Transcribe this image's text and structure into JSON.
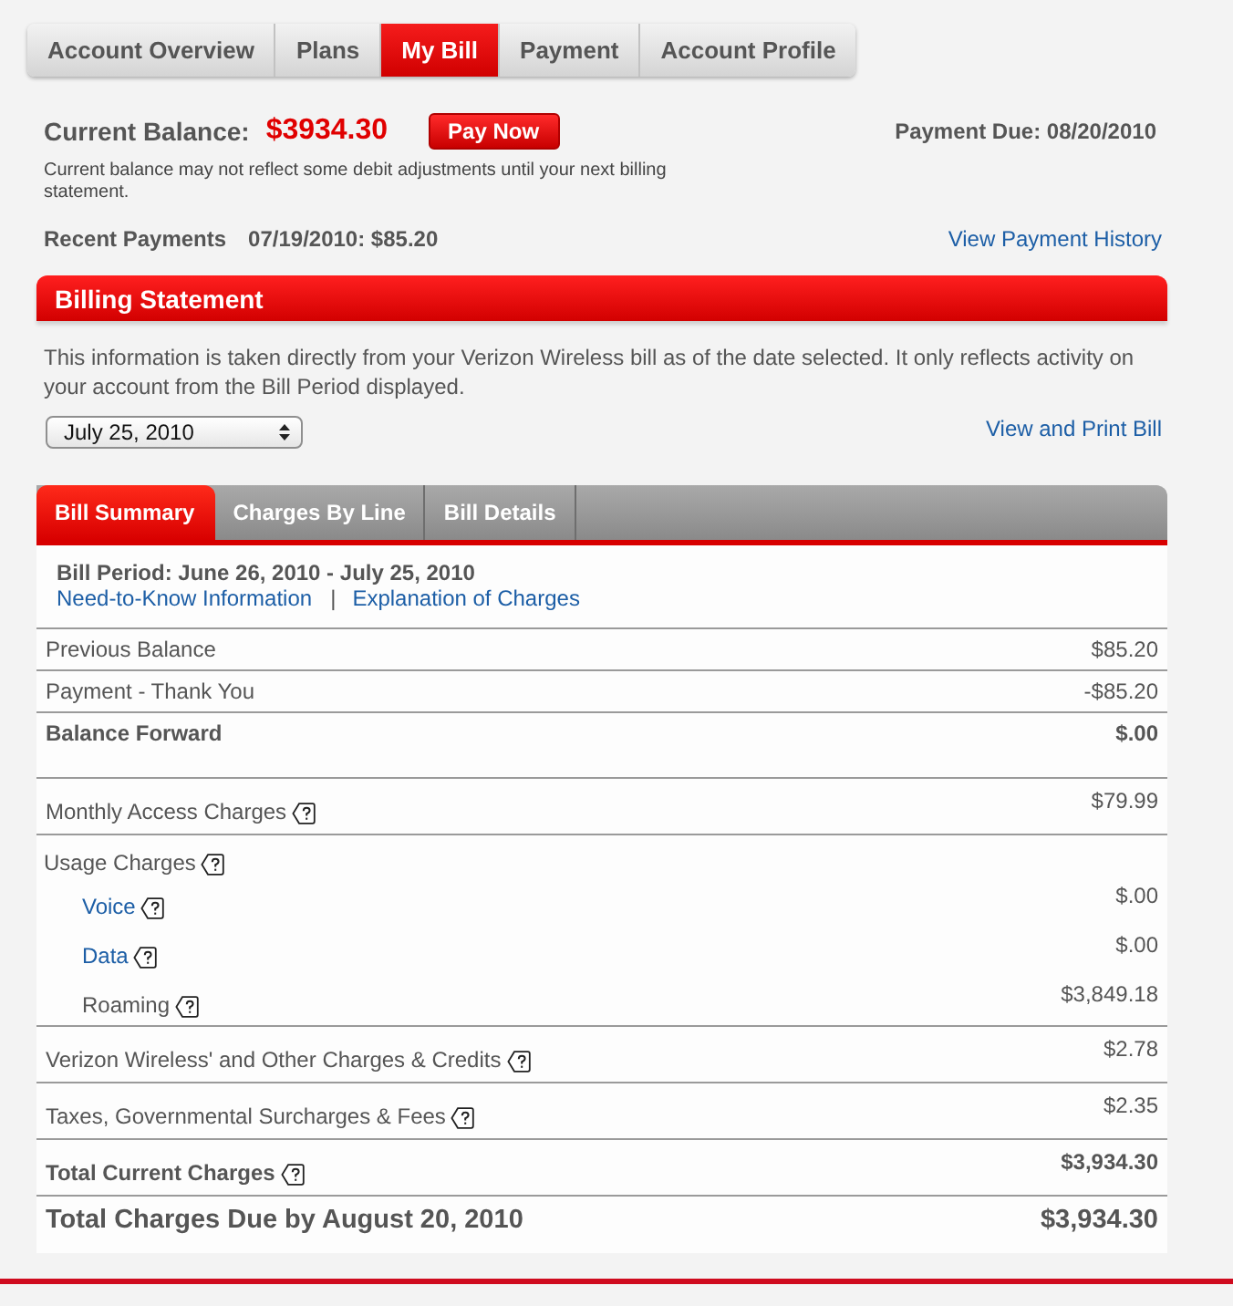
{
  "nav_tabs": [
    {
      "label": "Account Overview",
      "selected": false
    },
    {
      "label": "Plans",
      "selected": false
    },
    {
      "label": "My Bill",
      "selected": true
    },
    {
      "label": "Payment",
      "selected": false
    },
    {
      "label": "Account Profile",
      "selected": false
    }
  ],
  "balance": {
    "label": "Current Balance:",
    "amount": "$3934.30",
    "pay_button": "Pay Now",
    "payment_due": "Payment Due: 08/20/2010",
    "note": "Current balance may not reflect some debit adjustments until your next billing statement."
  },
  "recent_payments": {
    "label": "Recent Payments",
    "value": "07/19/2010: $85.20",
    "link": "View Payment History"
  },
  "billing_statement": {
    "title": "Billing Statement",
    "description": "This information is taken directly from your Verizon Wireless bill as of the date selected. It only reflects activity on your account from the Bill Period displayed.",
    "date_select": "July 25, 2010",
    "print_link": "View and Print Bill"
  },
  "bill_tabs": [
    {
      "label": "Bill Summary",
      "selected": true
    },
    {
      "label": "Charges By Line",
      "selected": false
    },
    {
      "label": "Bill Details",
      "selected": false
    }
  ],
  "bill_summary": {
    "period": "Bill Period: June 26, 2010 - July 25, 2010",
    "links": [
      "Need-to-Know Information",
      "Explanation of Charges"
    ],
    "link_separator": "|",
    "sections": [
      {
        "rows": [
          {
            "kind": "item",
            "label": "Previous Balance",
            "amount": "$85.20",
            "help": false
          },
          {
            "kind": "item",
            "label": "Payment - Thank You",
            "amount": "-$85.20",
            "help": false
          },
          {
            "kind": "subtotal",
            "label": "Balance Forward",
            "amount": "$.00",
            "help": false
          }
        ]
      },
      {
        "rows": [
          {
            "kind": "item",
            "label": "Monthly Access Charges",
            "amount": "$79.99",
            "help": true
          },
          {
            "kind": "group",
            "label": "Usage Charges",
            "help": true,
            "children": [
              {
                "kind": "link",
                "label": "Voice",
                "amount": "$.00",
                "help": true
              },
              {
                "kind": "link",
                "label": "Data",
                "amount": "$.00",
                "help": true
              },
              {
                "kind": "item",
                "label": "Roaming",
                "amount": "$3,849.18",
                "help": true
              }
            ]
          },
          {
            "kind": "item",
            "label": "Verizon Wireless' and Other Charges & Credits",
            "amount": "$2.78",
            "help": true
          },
          {
            "kind": "item",
            "label": "Taxes, Governmental Surcharges & Fees",
            "amount": "$2.35",
            "help": true
          },
          {
            "kind": "subtotal",
            "label": "Total Current Charges",
            "amount": "$3,934.30",
            "help": true
          },
          {
            "kind": "grand_total",
            "label": "Total Charges Due by August 20, 2010",
            "amount": "$3,934.30",
            "help": false
          }
        ]
      }
    ]
  }
}
